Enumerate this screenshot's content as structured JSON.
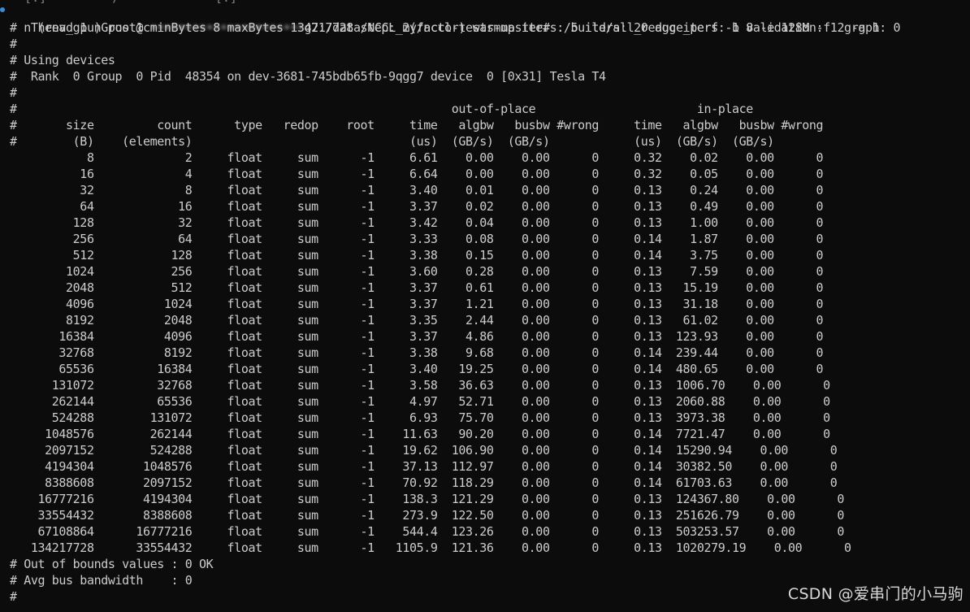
{
  "terminal": {
    "partial_top_line": "  [.]         /             [.]",
    "prompt": {
      "env": "(env_gpu)",
      "user_host_prefix": "root@c",
      "user_host_redacted": "••••••••••••••••••••••",
      "user_host_suffix": "g7:/data/NCCL_my/nccl-tests-master#",
      "command": "./build/all_reduce_perf -b 8 -e 128M -f 2 -g 1"
    },
    "header_lines": [
      "# nThread 1 nGpus 1 minBytes 8 maxBytes 134217728 step: 2(factor) warmup iters: 5 iters: 20 agg iters: 1 validation: 1 graph: 0",
      "#",
      "# Using devices",
      "#  Rank  0 Group  0 Pid  48354 on dev-3681-745bdb65fb-9qgg7 device  0 [0x31] Tesla T4",
      "#",
      "#                                                              out-of-place                       in-place",
      "#       size         count      type   redop    root     time   algbw   busbw #wrong     time   algbw   busbw #wrong",
      "#        (B)    (elements)                               (us)  (GB/s)  (GB/s)            (us)  (GB/s)  (GB/s)"
    ],
    "rows": [
      "           8             2     float     sum      -1     6.61    0.00    0.00      0     0.32    0.02    0.00      0",
      "          16             4     float     sum      -1     6.64    0.00    0.00      0     0.32    0.05    0.00      0",
      "          32             8     float     sum      -1     3.40    0.01    0.00      0     0.13    0.24    0.00      0",
      "          64            16     float     sum      -1     3.37    0.02    0.00      0     0.13    0.49    0.00      0",
      "         128            32     float     sum      -1     3.42    0.04    0.00      0     0.13    1.00    0.00      0",
      "         256            64     float     sum      -1     3.33    0.08    0.00      0     0.14    1.87    0.00      0",
      "         512           128     float     sum      -1     3.38    0.15    0.00      0     0.14    3.75    0.00      0",
      "        1024           256     float     sum      -1     3.60    0.28    0.00      0     0.13    7.59    0.00      0",
      "        2048           512     float     sum      -1     3.37    0.61    0.00      0     0.13   15.19    0.00      0",
      "        4096          1024     float     sum      -1     3.37    1.21    0.00      0     0.13   31.18    0.00      0",
      "        8192          2048     float     sum      -1     3.35    2.44    0.00      0     0.13   61.02    0.00      0",
      "       16384          4096     float     sum      -1     3.37    4.86    0.00      0     0.13  123.93    0.00      0",
      "       32768          8192     float     sum      -1     3.38    9.68    0.00      0     0.14  239.44    0.00      0",
      "       65536         16384     float     sum      -1     3.40   19.25    0.00      0     0.14  480.65    0.00      0",
      "      131072         32768     float     sum      -1     3.58   36.63    0.00      0     0.13  1006.70    0.00      0",
      "      262144         65536     float     sum      -1     4.97   52.71    0.00      0     0.13  2060.88    0.00      0",
      "      524288        131072     float     sum      -1     6.93   75.70    0.00      0     0.13  3973.38    0.00      0",
      "     1048576        262144     float     sum      -1    11.63   90.20    0.00      0     0.14  7721.47    0.00      0",
      "     2097152        524288     float     sum      -1    19.62  106.90    0.00      0     0.14  15290.94    0.00      0",
      "     4194304       1048576     float     sum      -1    37.13  112.97    0.00      0     0.14  30382.50    0.00      0",
      "     8388608       2097152     float     sum      -1    70.92  118.29    0.00      0     0.14  61703.63    0.00      0",
      "    16777216       4194304     float     sum      -1    138.3  121.29    0.00      0     0.13  124367.80    0.00      0",
      "    33554432       8388608     float     sum      -1    273.9  122.50    0.00      0     0.13  251626.79    0.00      0",
      "    67108864      16777216     float     sum      -1    544.4  123.26    0.00      0     0.13  503253.57    0.00      0",
      "   134217728      33554432     float     sum      -1   1105.9  121.36    0.00      0     0.13  1020279.19    0.00      0"
    ],
    "footer_lines": [
      "# Out of bounds values : 0 OK",
      "# Avg bus bandwidth    : 0",
      "#"
    ]
  },
  "watermark": "CSDN @爱串门的小马驹",
  "colors": {
    "background": "#0c0c0c",
    "foreground": "#cccccc",
    "prompt_marker": "#2f8fdd"
  }
}
